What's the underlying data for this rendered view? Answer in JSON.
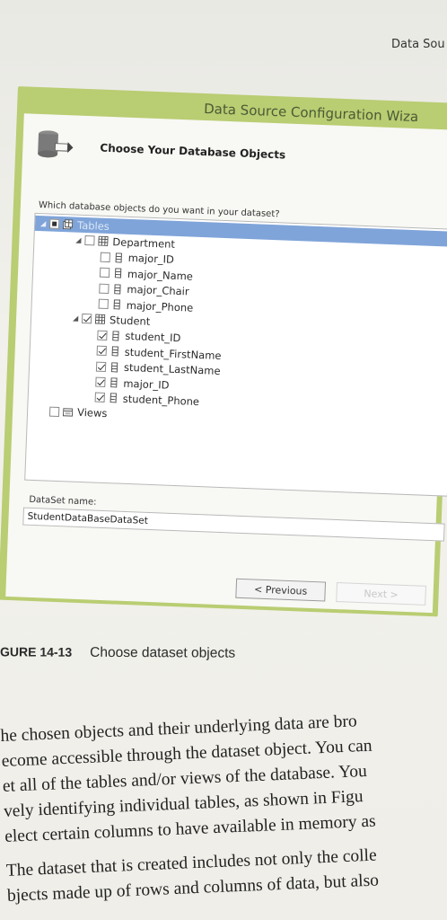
{
  "page_header": "Data Sou",
  "wizard": {
    "title": "Data Source Configuration Wiza",
    "step_title": "Choose Your Database Objects",
    "question": "Which database objects do you want in your dataset?",
    "tree": [
      {
        "label": "Tables",
        "level": 0,
        "checkbox": "partial",
        "icon": "tables-icon",
        "expanded": true,
        "selected": true
      },
      {
        "label": "Department",
        "level": 1,
        "checkbox": "unchecked",
        "icon": "table-icon",
        "expanded": true
      },
      {
        "label": "major_ID",
        "level": 2,
        "checkbox": "unchecked",
        "icon": "column-icon"
      },
      {
        "label": "major_Name",
        "level": 2,
        "checkbox": "unchecked",
        "icon": "column-icon"
      },
      {
        "label": "major_Chair",
        "level": 2,
        "checkbox": "unchecked",
        "icon": "column-icon"
      },
      {
        "label": "major_Phone",
        "level": 2,
        "checkbox": "unchecked",
        "icon": "column-icon"
      },
      {
        "label": "Student",
        "level": 1,
        "checkbox": "checked",
        "icon": "table-icon",
        "expanded": true
      },
      {
        "label": "student_ID",
        "level": 2,
        "checkbox": "checked",
        "icon": "column-icon"
      },
      {
        "label": "student_FirstName",
        "level": 2,
        "checkbox": "checked",
        "icon": "column-icon"
      },
      {
        "label": "student_LastName",
        "level": 2,
        "checkbox": "checked",
        "icon": "column-icon"
      },
      {
        "label": "major_ID",
        "level": 2,
        "checkbox": "checked",
        "icon": "column-icon"
      },
      {
        "label": "student_Phone",
        "level": 2,
        "checkbox": "checked",
        "icon": "column-icon"
      },
      {
        "label": "Views",
        "level": 0,
        "checkbox": "unchecked",
        "icon": "views-icon"
      }
    ],
    "dataset_label": "DataSet name:",
    "dataset_value": "StudentDataBaseDataSet",
    "previous_label": "< Previous",
    "next_label": "Next >",
    "accent_color": "#b9cd72",
    "selection_color": "#7fa4d9"
  },
  "caption": {
    "number": "GURE 14-13",
    "text": "Choose dataset objects"
  },
  "body_lines": [
    "he chosen objects and their underlying data are bro",
    "ecome accessible through the dataset object. You can",
    "et all of the tables and/or views of the database. You",
    "vely identifying individual tables, as shown in Figu",
    "elect certain columns to have available in memory as",
    "The dataset that is created includes not only the colle",
    "bjects made up of rows and columns of data, but also"
  ]
}
